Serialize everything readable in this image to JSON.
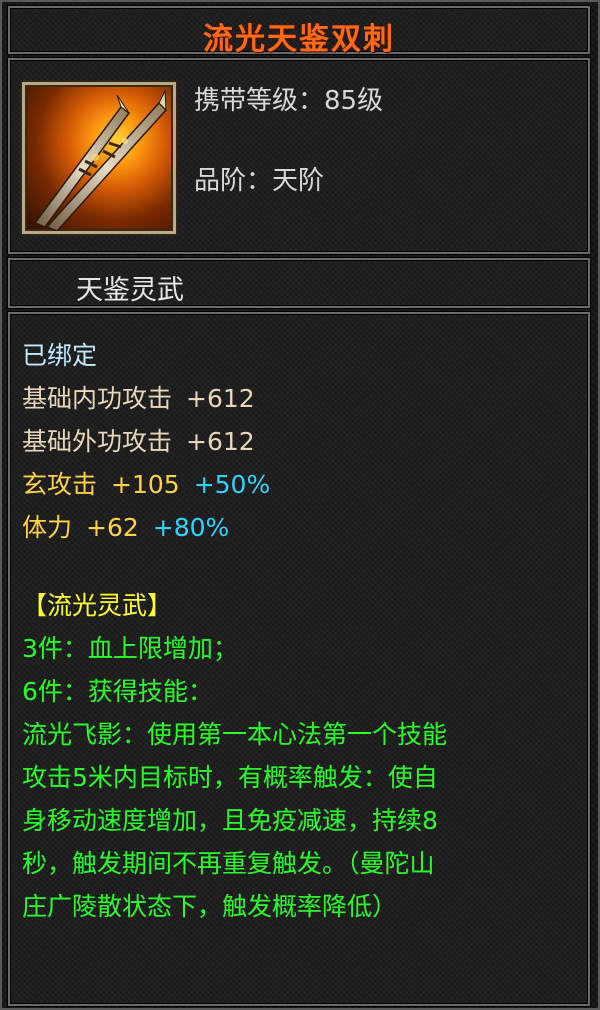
{
  "item": {
    "name": "流光天鉴双刺",
    "icon": "twin-daggers-icon",
    "level_label": "携带等级：",
    "level_value": "85级",
    "grade_label": "品阶：",
    "grade_value": "天阶",
    "category": "天鉴灵武"
  },
  "stats": {
    "bound": "已绑定",
    "base_internal": {
      "label": "基础内功攻击",
      "value": "+612"
    },
    "base_external": {
      "label": "基础外功攻击",
      "value": "+612"
    },
    "xuan_attack": {
      "label": "玄攻击",
      "value": "+105",
      "bonus": "+50%"
    },
    "stamina": {
      "label": "体力",
      "value": "+62",
      "bonus": "+80%"
    }
  },
  "set": {
    "name": "【流光灵武】",
    "bonus_3": "3件：血上限增加；",
    "bonus_6": "6件：获得技能：",
    "desc_lines": [
      "流光飞影：使用第一本心法第一个技能",
      "攻击5米内目标时，有概率触发：使自",
      "身移动速度增加，且免疫减速，持续8",
      "秒，触发期间不再重复触发。（曼陀山",
      "庄广陵散状态下，触发概率降低）"
    ]
  },
  "colors": {
    "title": "#ff6a1a",
    "bound": "#bfe9ff",
    "base_stat": "#e9d6b8",
    "extra_stat": "#ffd24a",
    "bonus": "#2fd3ff",
    "set_text": "#2bff2b",
    "set_name": "#ffff33"
  }
}
